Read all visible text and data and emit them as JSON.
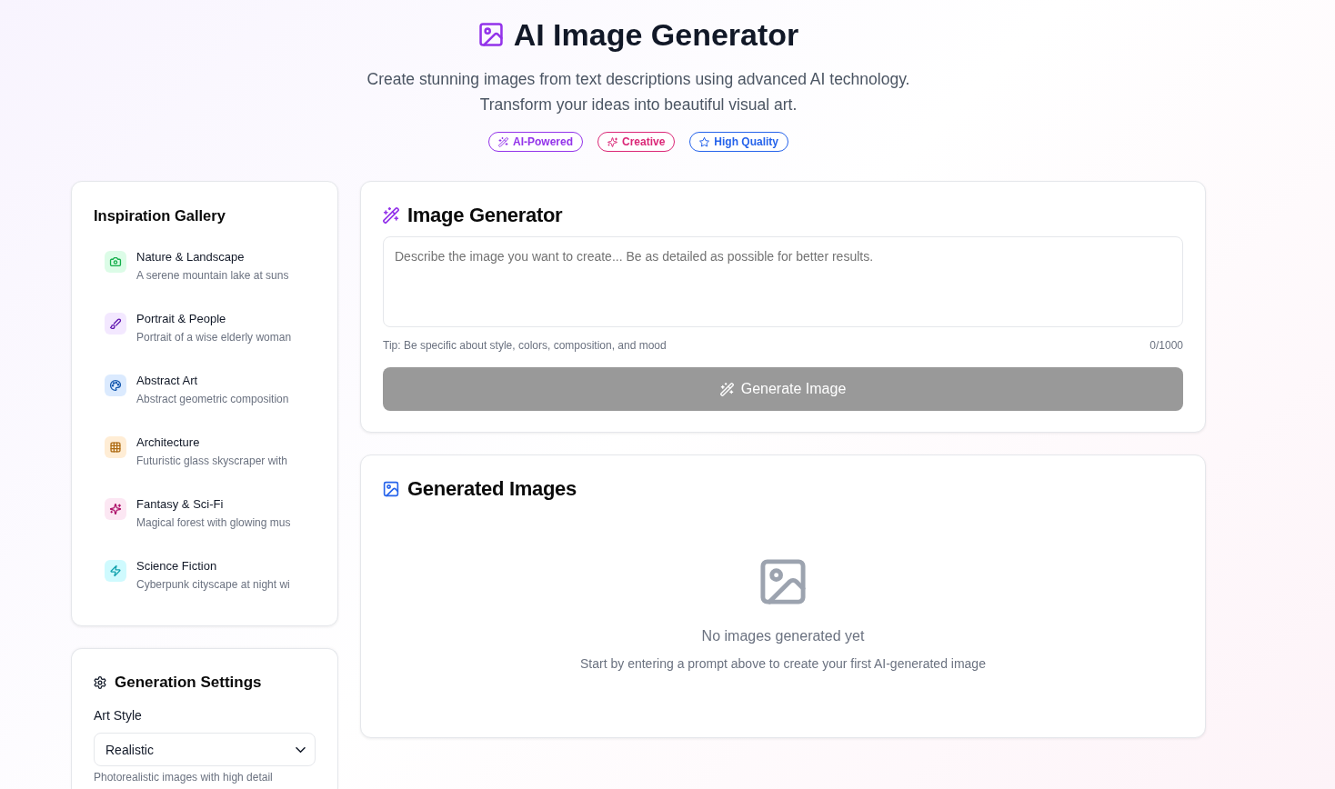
{
  "header": {
    "title": "AI Image Generator",
    "subtitle": "Create stunning images from text descriptions using advanced AI technology. Transform your ideas into beautiful visual art.",
    "badges": [
      {
        "label": "AI-Powered",
        "color": "#9333ea"
      },
      {
        "label": "Creative",
        "color": "#db2777"
      },
      {
        "label": "High Quality",
        "color": "#2563eb"
      }
    ]
  },
  "inspiration_gallery": {
    "title": "Inspiration Gallery",
    "items": [
      {
        "name": "Nature & Landscape",
        "description": "A serene mountain lake at suns",
        "color": "#dcfce7"
      },
      {
        "name": "Portrait & People",
        "description": "Portrait of a wise elderly woman",
        "color": "#f3e8ff"
      },
      {
        "name": "Abstract Art",
        "description": "Abstract geometric composition",
        "color": "#dbeafe"
      },
      {
        "name": "Architecture",
        "description": "Futuristic glass skyscraper with",
        "color": "#ffedd5"
      },
      {
        "name": "Fantasy & Sci-Fi",
        "description": "Magical forest with glowing mus",
        "color": "#fce7f3"
      },
      {
        "name": "Science Fiction",
        "description": "Cyberpunk cityscape at night wi",
        "color": "#cffafe"
      }
    ]
  },
  "generation_settings": {
    "title": "Generation Settings",
    "art_style": {
      "label": "Art Style",
      "value": "Realistic",
      "help": "Photorealistic images with high detail"
    }
  },
  "image_generator": {
    "title": "Image Generator",
    "prompt": {
      "placeholder": "Describe the image you want to create... Be as detailed as possible for better results.",
      "tip": "Tip: Be specific about style, colors, composition, and mood",
      "count": "0/1000"
    },
    "generate_button": {
      "label": "Generate Image",
      "disabled": true
    }
  },
  "generated_images": {
    "title": "Generated Images",
    "empty_title": "No images generated yet",
    "empty_text": "Start by entering a prompt above to create your first AI-generated image"
  }
}
